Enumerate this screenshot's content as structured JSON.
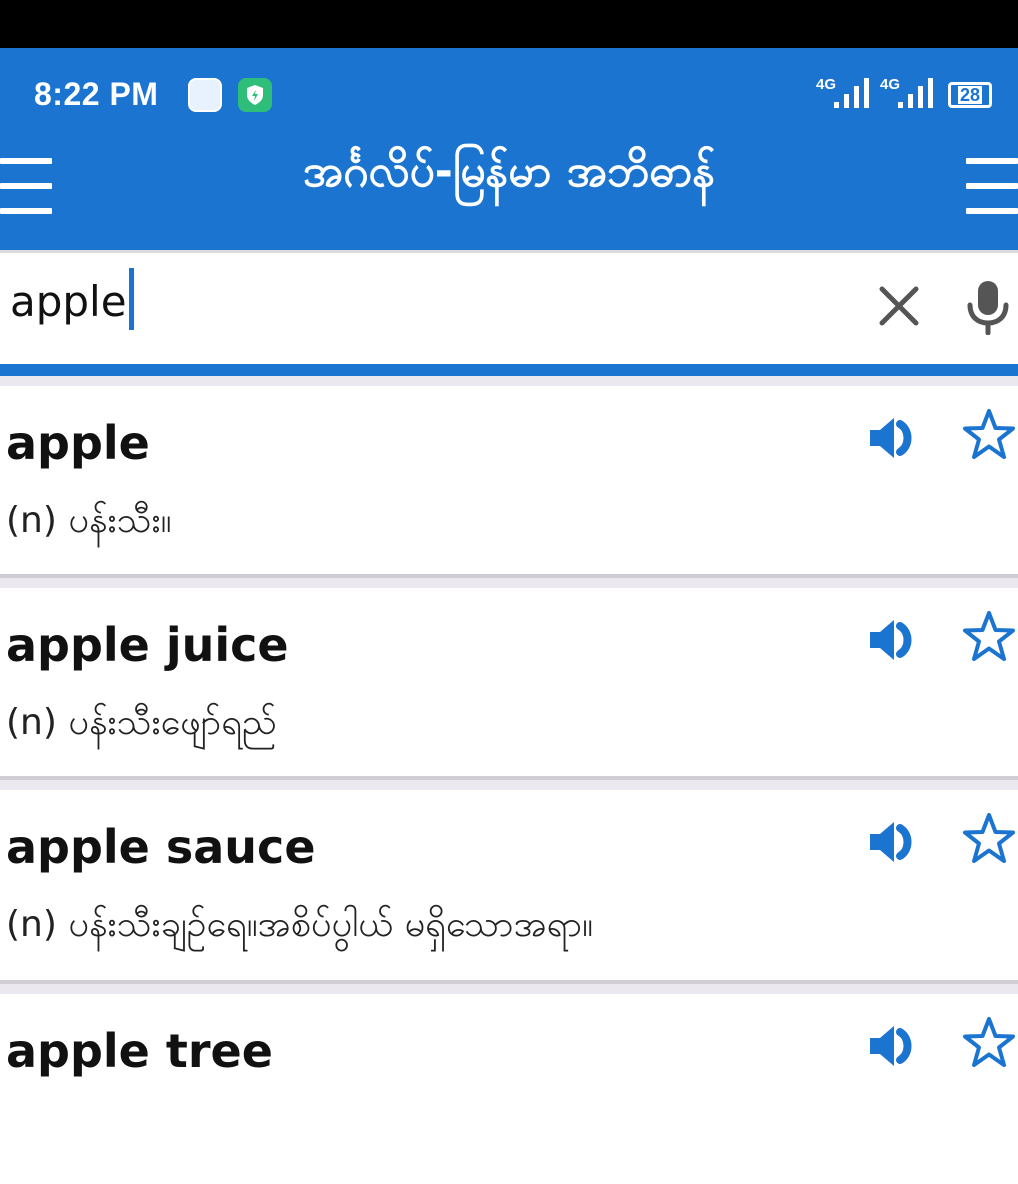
{
  "status_bar": {
    "time": "8:22 PM",
    "network_1": "4G",
    "network_2": "4G",
    "battery": "28",
    "icons": [
      "assistant-app-icon",
      "shield-app-icon"
    ]
  },
  "app_bar": {
    "title": "အင်္ဂလိပ်-မြန်မာ အဘိဓာန်",
    "colors": {
      "primary": "#1b74d0",
      "on_primary": "#ffffff"
    }
  },
  "search": {
    "value": "apple",
    "icons": [
      "close-icon",
      "microphone-icon"
    ]
  },
  "results": [
    {
      "word": "apple",
      "definition": "(n) ပန်းသီး။"
    },
    {
      "word": "apple juice",
      "definition": "(n) ပန်းသီးဖျော်ရည်"
    },
    {
      "word": "apple sauce",
      "definition": "(n) ပန်းသီးချဉ်ရေ။အစိပ်ပွါယ် မရှိသောအရာ။"
    },
    {
      "word": "apple tree",
      "definition": ""
    }
  ],
  "result_icons": [
    "speaker-icon",
    "star-outline-icon"
  ]
}
